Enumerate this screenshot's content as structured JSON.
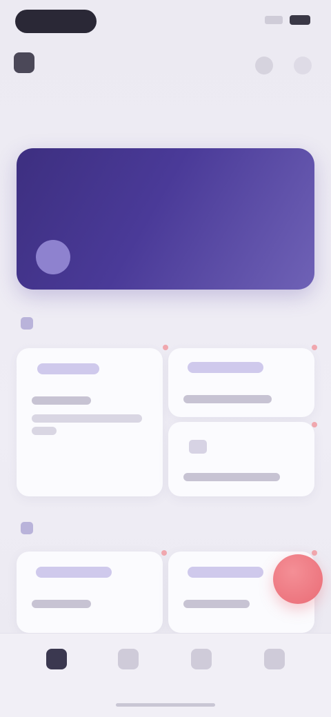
{
  "header": {
    "greeting": "",
    "subtitle": ""
  },
  "hero": {
    "title": "",
    "meta": ""
  },
  "sections": [
    {
      "title": ""
    },
    {
      "title": ""
    }
  ],
  "nav": {
    "items": [
      {
        "label": "",
        "icon": "home-icon"
      },
      {
        "label": "",
        "icon": "document-icon"
      },
      {
        "label": "",
        "icon": "chart-icon"
      },
      {
        "label": "",
        "icon": "profile-icon"
      }
    ]
  },
  "colors": {
    "hero_start": "#3d2f80",
    "hero_end": "#6f62b6",
    "fab": "#ea6c76",
    "background": "#eceaf2"
  }
}
